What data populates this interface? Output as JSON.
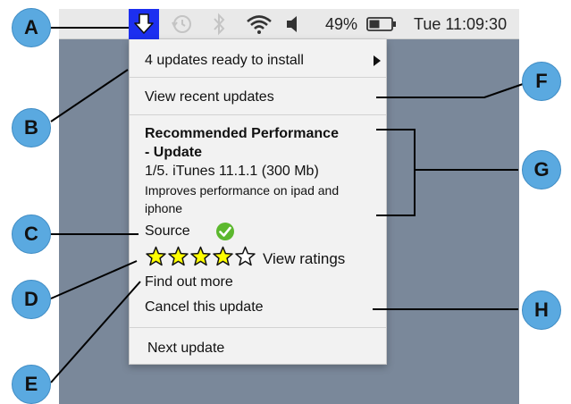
{
  "menubar": {
    "battery": "49%",
    "clock": "Tue 11:09:30",
    "icons": [
      "download-arrow-icon",
      "time-machine-icon",
      "bluetooth-icon",
      "wifi-icon",
      "speaker-icon",
      "battery-icon"
    ]
  },
  "menu": {
    "updates_ready": "4 updates ready to install",
    "view_recent": "View recent updates",
    "title_line1": "Recommended Performance",
    "title_line2": "- Update",
    "detail": "1/5. iTunes 11.1.1 (300 Mb)",
    "desc_line1": "Improves performance on ipad and",
    "desc_line2": "iphone",
    "source": "Source",
    "rating_filled": 4,
    "rating_total": 5,
    "view_ratings": "View ratings",
    "find_out_more": "Find out more",
    "cancel": "Cancel this update",
    "next": "Next update"
  },
  "callouts": {
    "a": "A",
    "b": "B",
    "c": "C",
    "d": "D",
    "e": "E",
    "f": "F",
    "g": "G",
    "h": "H"
  },
  "colors": {
    "desktop": "#7a889a",
    "highlight": "#1c2ff0",
    "callout": "#5aa9e0",
    "star": "#ffff00",
    "check": "#5cb82e"
  }
}
